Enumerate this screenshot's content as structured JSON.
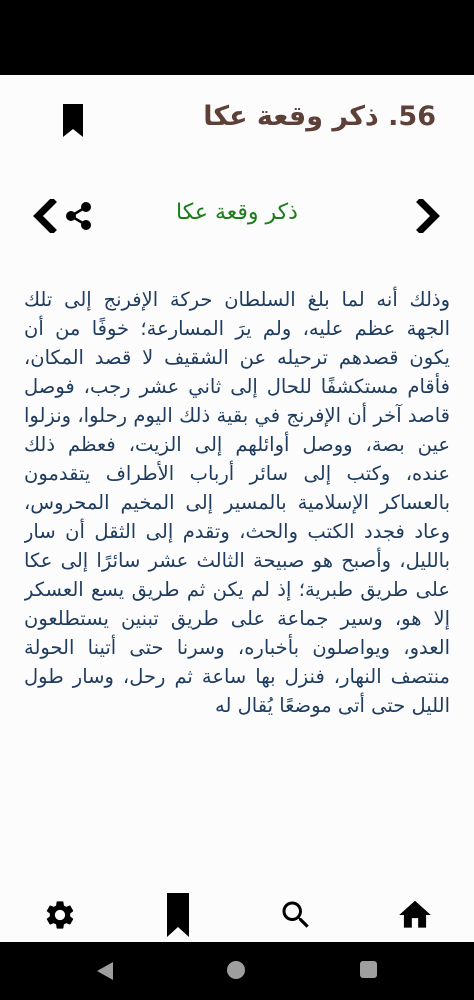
{
  "header": {
    "chapter_title": "56. ذكر وقعة عكا"
  },
  "nav": {
    "section_title": "ذكر وقعة عكا"
  },
  "content": {
    "paragraph": "وذلك أنه لما بلغ السلطان حركة الإفرنج إلى تلك الجهة عظم عليه، ولم يرَ المسارعة؛ خوفًا من أن يكون قصدهم ترحيله عن الشقيف لا قصد المكان، فأقام مستكشفًا للحال إلى ثاني عشر رجب، فوصل قاصد آخر أن الإفرنج في بقية ذلك اليوم رحلوا، ونزلوا عين بصة، ووصل أوائلهم إلى الزيت، فعظم ذلك عنده، وكتب إلى سائر أرباب الأطراف يتقدمون بالعساكر الإسلامية بالمسير إلى المخيم المحروس، وعاد فجدد الكتب والحث، وتقدم إلى الثقل أن سار بالليل، وأصبح هو صبيحة الثالث عشر سائرًا إلى عكا على طريق طبرية؛ إذ لم يكن ثم طريق يسع العسكر إلا هو، وسير جماعة على طريق تبنين يستطلعون العدو، ويواصلون بأخباره، وسرنا حتى أتينا الحولة منتصف النهار، فنزل بها ساعة ثم رحل، وسار طول الليل حتى أتى موضعًا يُقال له"
  },
  "icons": {
    "bookmark_top": "bookmark-icon",
    "prev": "chevron-left-icon",
    "share": "share-icon",
    "next": "chevron-right-icon",
    "settings": "gear-icon",
    "bookmarks": "bookmark-icon",
    "search": "search-icon",
    "home": "home-icon"
  },
  "colors": {
    "title": "#5d4037",
    "section_title": "#1b7d1b",
    "body_text": "#1f3c5e",
    "background": "#fcfcfc"
  }
}
